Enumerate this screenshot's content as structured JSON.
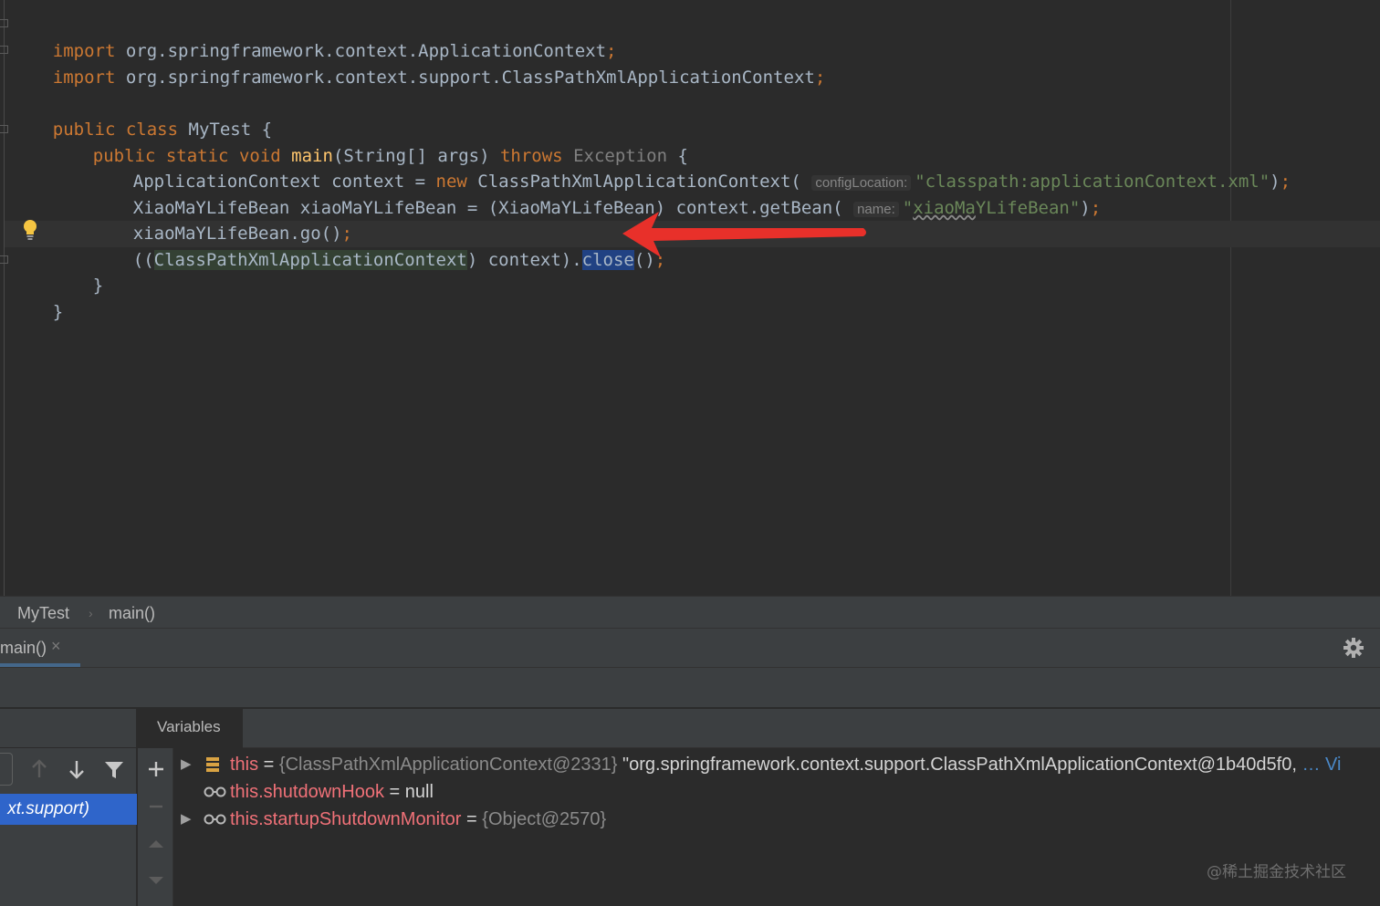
{
  "editor": {
    "lines": {
      "import1": {
        "kw": "import",
        "rest": " org.springframework.context.ApplicationContext",
        "semi": ";"
      },
      "import2": {
        "kw": "import",
        "rest": " org.springframework.context.support.ClassPathXmlApplicationContext",
        "semi": ";"
      },
      "class_decl": {
        "kw1": "public",
        "kw2": "class",
        "name": " MyTest {"
      },
      "main_decl": {
        "kw1": "public",
        "kw2": "static",
        "kw3": "void",
        "fn": "main",
        "params": "(String[] args) ",
        "throws": "throws",
        "exc": "Exception",
        "brace": " {"
      },
      "line_context": {
        "pre": "ApplicationContext context = ",
        "kw": "new",
        "mid": " ClassPathXmlApplicationContext(",
        "hint": "configLocation:",
        "str": "\"classpath:applicationContext.xml\"",
        "end": ")",
        "semi": ";"
      },
      "line_getbean": {
        "pre": "XiaoMaYLifeBean xiaoMaYLifeBean = (XiaoMaYLifeBean) context.getBean(",
        "hint": "name:",
        "str_q1": "\"",
        "str_squig": "xiaoMa",
        "str_rest": "YLifeBean\"",
        "end": ")",
        "semi": ";"
      },
      "line_go": {
        "text": "xiaoMaYLifeBean.go()",
        "semi": ";"
      },
      "line_close": {
        "pre": "((",
        "type": "ClassPathXmlApplicationContext",
        "mid": ") context).",
        "sel": "close",
        "end": "()",
        "semi": ";"
      },
      "close_method": "}",
      "close_class": "}"
    }
  },
  "breadcrumb": {
    "item1": "MyTest",
    "separator": "›",
    "item2": "main()"
  },
  "debug": {
    "tab_label": "main()",
    "tab_close": "×",
    "frame_selected": "xt.support)",
    "variables_tab": "Variables",
    "variables": [
      {
        "name": "this",
        "eq": " = ",
        "value_gray": "{ClassPathXmlApplicationContext@2331}",
        "value_white": " \"org.springframework.context.support.ClassPathXmlApplicationContext@1b40d5f0,",
        "ellipsis": " …",
        "view": " Vi"
      },
      {
        "name": "this.shutdownHook",
        "eq": " = ",
        "value_white": "null"
      },
      {
        "name": "this.startupShutdownMonitor",
        "eq": " = ",
        "value_gray": "{Object@2570}"
      }
    ]
  },
  "watermark": "@稀土掘金技术社区",
  "colors": {
    "background": "#2b2b2b",
    "keyword": "#cc7832",
    "string": "#6a8759",
    "selection": "#214283",
    "frame_selected": "#2f65ca",
    "arrow": "#e8302a"
  },
  "icons": [
    "lightbulb-icon",
    "arrow-annotation-icon",
    "gear-icon",
    "up-arrow-icon",
    "down-arrow-icon",
    "filter-icon",
    "add-icon",
    "expand-triangle-icon",
    "field-stack-icon",
    "watch-glasses-icon"
  ]
}
